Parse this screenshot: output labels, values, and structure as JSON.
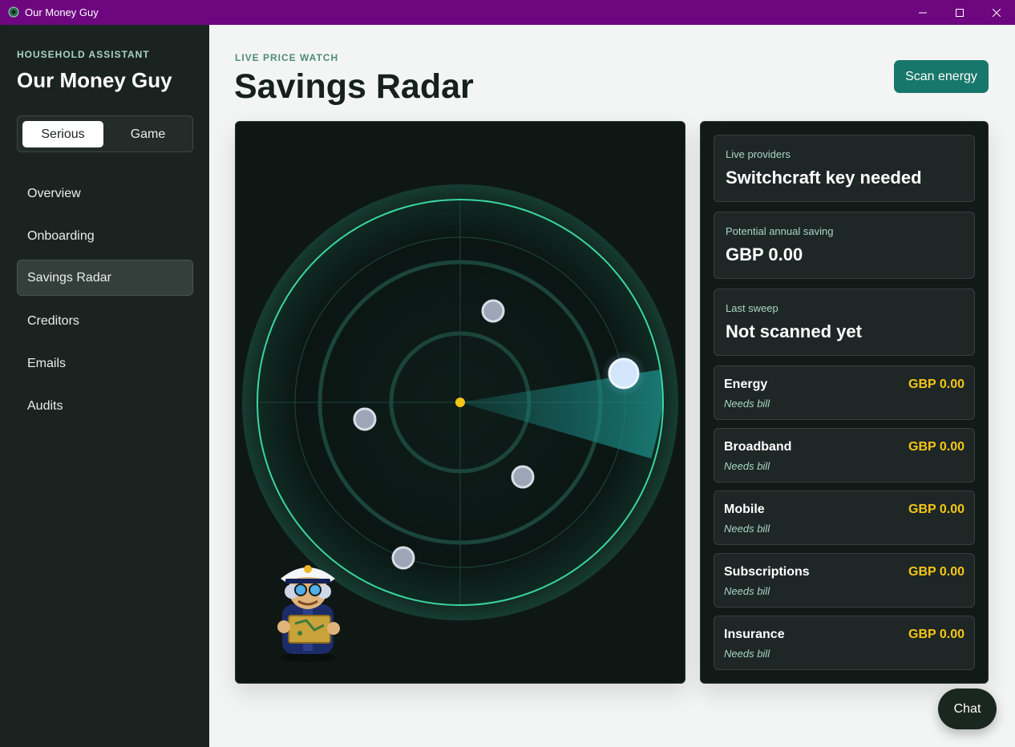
{
  "window": {
    "title": "Our Money Guy",
    "controls": {
      "minimize": "—",
      "maximize": "☐",
      "close": "✕"
    }
  },
  "sidebar": {
    "eyebrow": "HOUSEHOLD ASSISTANT",
    "brand": "Our Money Guy",
    "modes": [
      "Serious",
      "Game"
    ],
    "active_mode": "Serious",
    "items": [
      {
        "label": "Overview"
      },
      {
        "label": "Onboarding"
      },
      {
        "label": "Savings Radar",
        "active": true
      },
      {
        "label": "Creditors"
      },
      {
        "label": "Emails"
      },
      {
        "label": "Audits"
      }
    ]
  },
  "header": {
    "eyebrow": "LIVE PRICE WATCH",
    "title": "Savings Radar",
    "scan_button": "Scan energy"
  },
  "stats": [
    {
      "label": "Live providers",
      "value": "Switchcraft key needed"
    },
    {
      "label": "Potential annual saving",
      "value": "GBP 0.00"
    },
    {
      "label": "Last sweep",
      "value": "Not scanned yet"
    }
  ],
  "categories": [
    {
      "name": "Energy",
      "amount": "GBP 0.00",
      "status": "Needs bill"
    },
    {
      "name": "Broadband",
      "amount": "GBP 0.00",
      "status": "Needs bill"
    },
    {
      "name": "Mobile",
      "amount": "GBP 0.00",
      "status": "Needs bill"
    },
    {
      "name": "Subscriptions",
      "amount": "GBP 0.00",
      "status": "Needs bill"
    },
    {
      "name": "Insurance",
      "amount": "GBP 0.00",
      "status": "Needs bill"
    }
  ],
  "chat_button": "Chat",
  "colors": {
    "titlebar": "#6e0680",
    "accent": "#17776a",
    "radar_ring": "#3ad6a0",
    "amount": "#f5c518",
    "center_dot": "#f5c518"
  },
  "icons": {
    "app": "gear-icon",
    "mascot": "captain-mascot-icon"
  }
}
